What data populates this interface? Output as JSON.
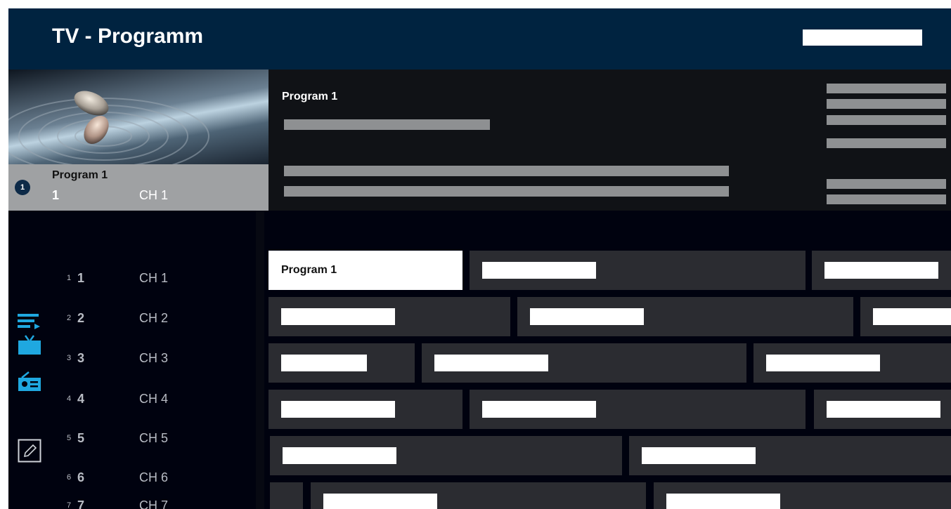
{
  "header": {
    "title": "TV - Programm"
  },
  "current_channel": {
    "badge": "1",
    "program": "Program 1",
    "number": "1",
    "channel": "CH 1"
  },
  "info": {
    "title": "Program 1"
  },
  "sidebar_icons": [
    "playlist-icon",
    "tv-icon",
    "radio-icon",
    "edit-icon"
  ],
  "accent_color": "#1fa8e0",
  "channels": [
    {
      "small": "1",
      "big": "1",
      "name": "CH 1"
    },
    {
      "small": "2",
      "big": "2",
      "name": "CH 2"
    },
    {
      "small": "3",
      "big": "3",
      "name": "CH 3"
    },
    {
      "small": "4",
      "big": "4",
      "name": "CH 4"
    },
    {
      "small": "5",
      "big": "5",
      "name": "CH 5"
    },
    {
      "small": "6",
      "big": "6",
      "name": "CH 6"
    },
    {
      "small": "7",
      "big": "7",
      "name": "CH 7"
    }
  ],
  "guide": {
    "selected_program": "Program 1"
  }
}
